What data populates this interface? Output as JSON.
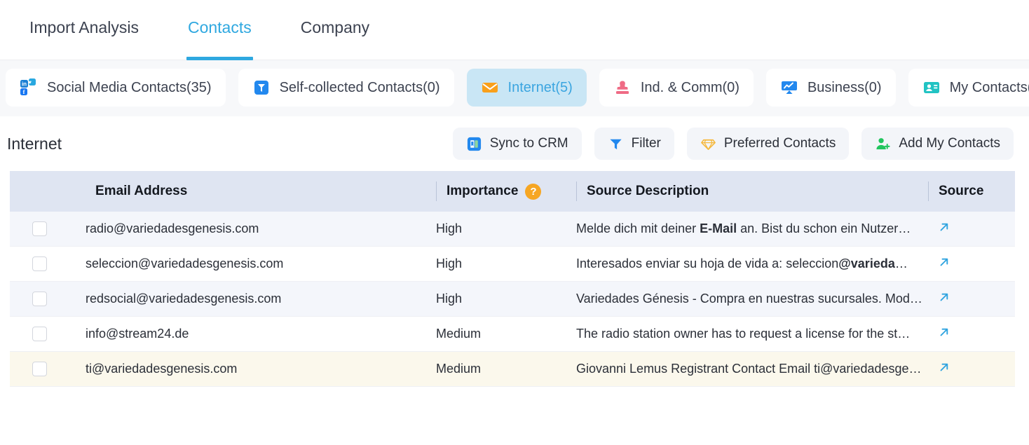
{
  "topnav": {
    "tabs": [
      {
        "label": "Import Analysis",
        "active": false
      },
      {
        "label": "Contacts",
        "active": true
      },
      {
        "label": "Company",
        "active": false
      }
    ],
    "active_color": "#2fa8e0"
  },
  "chips": [
    {
      "label": "Social Media Contacts(35)",
      "icon": "social-media-icon",
      "selected": false
    },
    {
      "label": "Self-collected Contacts(0)",
      "icon": "funnel-square-icon",
      "selected": false
    },
    {
      "label": "Internet(5)",
      "icon": "envelope-icon",
      "selected": true
    },
    {
      "label": "Ind. & Comm(0)",
      "icon": "stamp-icon",
      "selected": false
    },
    {
      "label": "Business(0)",
      "icon": "chart-board-icon",
      "selected": false
    },
    {
      "label": "My Contacts(--)",
      "icon": "id-card-icon",
      "selected": false
    }
  ],
  "section": {
    "title": "Internet",
    "buttons": [
      {
        "label": "Sync to CRM",
        "icon": "crm-book-icon"
      },
      {
        "label": "Filter",
        "icon": "filter-funnel-icon"
      },
      {
        "label": "Preferred Contacts",
        "icon": "diamond-icon"
      },
      {
        "label": "Add My Contacts",
        "icon": "person-plus-icon"
      }
    ]
  },
  "table": {
    "columns": [
      {
        "key": "checkbox",
        "label": ""
      },
      {
        "key": "email",
        "label": "Email Address"
      },
      {
        "key": "importance",
        "label": "Importance",
        "help": "?"
      },
      {
        "key": "description",
        "label": "Source Description"
      },
      {
        "key": "source",
        "label": "Source"
      }
    ],
    "rows": [
      {
        "email": "radio@variedadesgenesis.com",
        "importance": "High",
        "desc_prefix": "Melde dich mit deiner ",
        "desc_bold": "E-Mail",
        "desc_suffix": " an. Bist du schon ein Nutzer…",
        "source_icon": "external-link-arrow-icon",
        "highlight": "alt"
      },
      {
        "email": "seleccion@variedadesgenesis.com",
        "importance": "High",
        "desc_prefix": "Interesados enviar su hoja de vida a: seleccion",
        "desc_bold": "@varieda",
        "desc_suffix": "…",
        "source_icon": "external-link-arrow-icon",
        "highlight": "plain"
      },
      {
        "email": "redsocial@variedadesgenesis.com",
        "importance": "High",
        "desc_prefix": "Variedades Génesis - Compra en nuestras sucursales. Mod…",
        "desc_bold": "",
        "desc_suffix": "",
        "source_icon": "external-link-arrow-icon",
        "highlight": "alt"
      },
      {
        "email": "info@stream24.de",
        "importance": "Medium",
        "desc_prefix": "The radio station owner has to request a license for the st…",
        "desc_bold": "",
        "desc_suffix": "",
        "source_icon": "external-link-arrow-icon",
        "highlight": "plain"
      },
      {
        "email": "ti@variedadesgenesis.com",
        "importance": "Medium",
        "desc_prefix": "Giovanni Lemus Registrant Contact Email ti@variedadesge…",
        "desc_bold": "",
        "desc_suffix": "",
        "source_icon": "external-link-arrow-icon",
        "highlight": "hl"
      }
    ]
  },
  "colors": {
    "accent_blue": "#2fa8e0",
    "chip_selected_bg": "#c9e6f5",
    "header_bg": "#dfe5f2",
    "row_alt_bg": "#f4f6fb",
    "row_highlight_bg": "#fbf8ec",
    "help_badge": "#f6a623",
    "envelope_orange": "#f9a01b",
    "stamp_pink": "#ef6b85",
    "diamond_gold": "#f5b93f",
    "person_green": "#22c55e",
    "teal": "#22c3c3"
  }
}
